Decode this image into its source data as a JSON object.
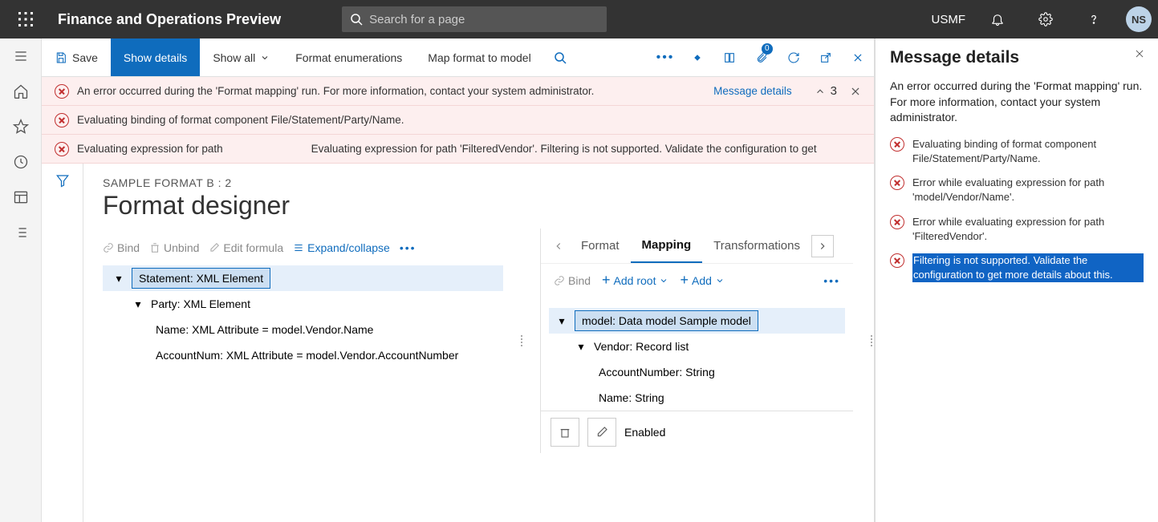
{
  "topbar": {
    "appTitle": "Finance and Operations Preview",
    "searchPlaceholder": "Search for a page",
    "company": "USMF",
    "avatar": "NS"
  },
  "actionbar": {
    "save": "Save",
    "showDetails": "Show details",
    "showAll": "Show all",
    "formatEnum": "Format enumerations",
    "mapModel": "Map format to model",
    "badge": "0"
  },
  "messages": {
    "m1": "An error occurred during the 'Format mapping' run. For more information, contact your system administrator.",
    "m2": "Evaluating binding of format component File/Statement/Party/Name.",
    "m3_left": "Evaluating expression for path",
    "m3_right": "Evaluating expression for path 'FilteredVendor'. Filtering is not supported. Validate the configuration to get",
    "detailsLink": "Message details",
    "count": "3"
  },
  "designer": {
    "crumb": "SAMPLE FORMAT B : 2",
    "title": "Format designer",
    "tools": {
      "bind": "Bind",
      "unbind": "Unbind",
      "edit": "Edit formula",
      "expand": "Expand/collapse"
    },
    "formatTree": {
      "root": "Statement: XML Element",
      "child": "Party: XML Element",
      "leaf1": "Name: XML Attribute = model.Vendor.Name",
      "leaf2": "AccountNum: XML Attribute = model.Vendor.AccountNumber"
    },
    "tabs": {
      "format": "Format",
      "mapping": "Mapping",
      "transform": "Transformations"
    },
    "mapToolbar": {
      "bind": "Bind",
      "addRoot": "Add root",
      "add": "Add"
    },
    "mapTree": {
      "root": "model: Data model Sample model",
      "vendor": "Vendor: Record list",
      "acct": "AccountNumber: String",
      "name": "Name: String"
    },
    "bottom": {
      "enabled": "Enabled"
    }
  },
  "panel": {
    "title": "Message details",
    "intro": "An error occurred during the 'Format mapping' run. For more information, contact your system administrator.",
    "rows": [
      "Evaluating binding of format component File/Statement/Party/Name.",
      "Error while evaluating expression for path 'model/Vendor/Name'.",
      "Error while evaluating expression for path 'FilteredVendor'."
    ],
    "highlight": "Filtering is not supported. Validate the configuration to get more details about this."
  }
}
